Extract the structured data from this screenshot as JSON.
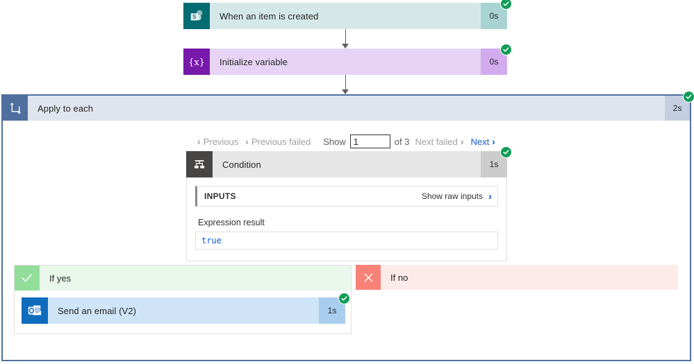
{
  "flow": {
    "trigger": {
      "title": "When an item is created",
      "duration": "0s",
      "icon": "sharepoint-icon",
      "status": "succeeded"
    },
    "initialize_variable": {
      "title": "Initialize variable",
      "duration": "0s",
      "icon": "variable-braces-icon",
      "status": "succeeded"
    },
    "apply_to_each": {
      "title": "Apply to each",
      "duration": "2s",
      "icon": "loop-icon",
      "status": "succeeded"
    },
    "condition": {
      "title": "Condition",
      "duration": "1s",
      "icon": "condition-branch-icon",
      "status": "succeeded"
    },
    "send_email": {
      "title": "Send an email (V2)",
      "duration": "1s",
      "icon": "outlook-icon",
      "status": "succeeded"
    }
  },
  "pager": {
    "previous_label": "Previous",
    "previous_failed_label": "Previous failed",
    "show_label": "Show",
    "show_value": "1",
    "show_placeholder": "1",
    "of_label": "of 3",
    "next_failed_label": "Next failed",
    "next_label": "Next"
  },
  "inputs_panel": {
    "section_title": "INPUTS",
    "raw_inputs_link": "Show raw inputs",
    "expression_result_label": "Expression result",
    "expression_result_value": "true"
  },
  "branches": {
    "yes": {
      "label": "If yes",
      "icon": "checkmark-icon"
    },
    "no": {
      "label": "If no",
      "icon": "cross-icon"
    }
  },
  "colors": {
    "sharepoint": "#036c70",
    "variable": "#7719aa",
    "loop": "#4f6f9e",
    "condition": "#484644",
    "outlook": "#0f6cbd",
    "success_badge": "#0f9d58",
    "branch_yes": "#93dd9b",
    "branch_no": "#f98277",
    "link": "#0b5cd5"
  }
}
